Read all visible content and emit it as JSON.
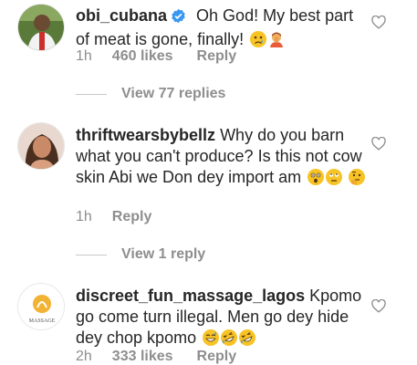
{
  "comments": [
    {
      "username": "obi_cubana",
      "text": "Oh God! My best part of meat is gone, finally!",
      "time": "1h",
      "likes": "460 likes",
      "reply": "Reply",
      "emojis": [
        "sad-face-emoji",
        "person-facepalming-emoji"
      ]
    },
    {
      "username": "thriftwearsbybellz",
      "text": "Why do you barn what you can't produce? Is this not cow skin Abi we Don dey import am",
      "time": "1h",
      "reply": "Reply",
      "emojis": [
        "astonished-face-emoji",
        "eye-roll-emoji",
        "thinking-face-emoji"
      ]
    },
    {
      "username": "discreet_fun_massage_lagos",
      "text": "Kpomo go come turn illegal. Men go dey hide dey chop kpomo",
      "time": "2h",
      "likes": "333 likes",
      "reply": "Reply",
      "emojis": [
        "grinning-sweat-emoji",
        "rolling-laughing-emoji",
        "rolling-laughing-emoji"
      ],
      "avatar_text": "MASSAGE"
    }
  ],
  "threads": [
    {
      "label": "View 77 replies"
    },
    {
      "label": "View 1 reply"
    }
  ],
  "colors": {
    "secondary": "#8e8e8e",
    "verified": "#3897f0",
    "emoji": "#f7c325"
  }
}
